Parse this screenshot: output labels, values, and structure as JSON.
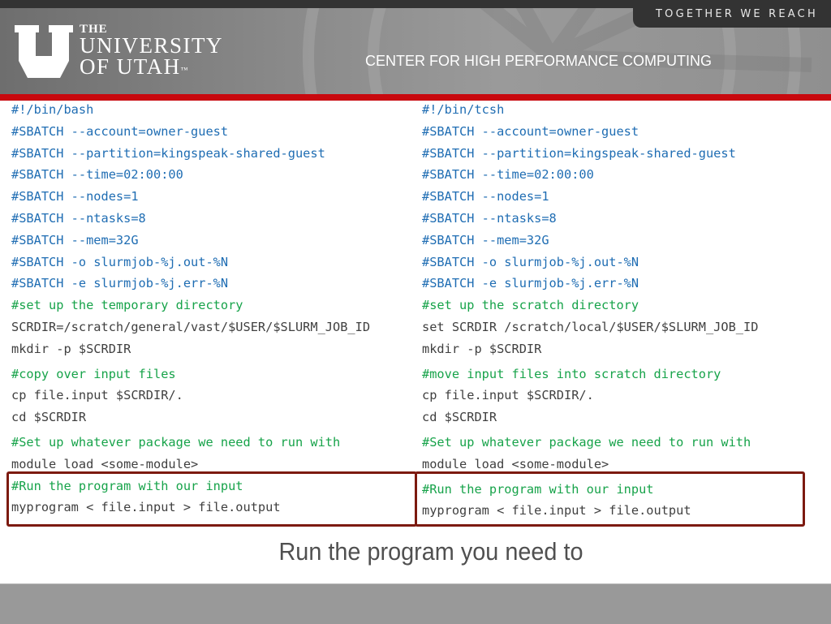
{
  "header": {
    "tagline": "TOGETHER WE REACH",
    "logo": {
      "line1": "THE",
      "line2": "UNIVERSITY",
      "line3": "OF UTAH",
      "trademark": "™"
    },
    "center_title": "CENTER FOR HIGH PERFORMANCE COMPUTING",
    "colors": {
      "red_bar": "#c8080e",
      "top_bar": "#333333"
    }
  },
  "left_script": {
    "shell": "bash",
    "lines": [
      {
        "type": "directive",
        "text": "#!/bin/bash"
      },
      {
        "type": "directive",
        "text": "#SBATCH --account=owner-guest"
      },
      {
        "type": "directive",
        "text": "#SBATCH --partition=kingspeak-shared-guest"
      },
      {
        "type": "directive",
        "text": "#SBATCH --time=02:00:00"
      },
      {
        "type": "directive",
        "text": "#SBATCH --nodes=1"
      },
      {
        "type": "directive",
        "text": "#SBATCH --ntasks=8"
      },
      {
        "type": "directive",
        "text": "#SBATCH --mem=32G"
      },
      {
        "type": "directive",
        "text": "#SBATCH -o slurmjob-%j.out-%N"
      },
      {
        "type": "directive",
        "text": "#SBATCH -e slurmjob-%j.err-%N"
      },
      {
        "type": "comment",
        "text": "#set up the temporary directory"
      },
      {
        "type": "plain",
        "text": "SCRDIR=/scratch/general/vast/$USER/$SLURM_JOB_ID"
      },
      {
        "type": "plain",
        "text": "mkdir -p $SCRDIR"
      },
      {
        "type": "comment",
        "text": "#copy over input files"
      },
      {
        "type": "plain",
        "text": "cp file.input $SCRDIR/."
      },
      {
        "type": "plain",
        "text": "cd $SCRDIR"
      },
      {
        "type": "comment",
        "text": "#Set up whatever package we need to run with"
      },
      {
        "type": "plain",
        "text": "module load <some-module>"
      },
      {
        "type": "comment",
        "text": "#Run the program with our input"
      },
      {
        "type": "plain",
        "text": "myprogram < file.input > file.output"
      }
    ]
  },
  "right_script": {
    "shell": "tcsh",
    "lines": [
      {
        "type": "directive",
        "text": "#!/bin/tcsh"
      },
      {
        "type": "directive",
        "text": "#SBATCH --account=owner-guest"
      },
      {
        "type": "directive",
        "text": "#SBATCH --partition=kingspeak-shared-guest"
      },
      {
        "type": "directive",
        "text": "#SBATCH --time=02:00:00"
      },
      {
        "type": "directive",
        "text": "#SBATCH --nodes=1"
      },
      {
        "type": "directive",
        "text": "#SBATCH --ntasks=8"
      },
      {
        "type": "directive",
        "text": "#SBATCH --mem=32G"
      },
      {
        "type": "directive",
        "text": "#SBATCH -o slurmjob-%j.out-%N"
      },
      {
        "type": "directive",
        "text": "#SBATCH -e slurmjob-%j.err-%N"
      },
      {
        "type": "comment",
        "text": "#set up the scratch directory"
      },
      {
        "type": "plain",
        "text": "set SCRDIR /scratch/local/$USER/$SLURM_JOB_ID"
      },
      {
        "type": "plain",
        "text": "mkdir -p $SCRDIR"
      },
      {
        "type": "comment",
        "text": "#move input files into scratch directory"
      },
      {
        "type": "plain",
        "text": "cp file.input $SCRDIR/."
      },
      {
        "type": "plain",
        "text": "cd $SCRDIR"
      },
      {
        "type": "comment",
        "text": "#Set up whatever package we need to run with"
      },
      {
        "type": "plain",
        "text": "module load <some-module>"
      },
      {
        "type": "comment",
        "text": "#Run the program with our input"
      },
      {
        "type": "plain",
        "text": "myprogram < file.input > file.output"
      }
    ]
  },
  "code_colors": {
    "directive": "#1f6db3",
    "comment": "#17a34a",
    "plain": "#404040",
    "highlight_box": "#7c1a10"
  },
  "caption": "Run the program you need to"
}
